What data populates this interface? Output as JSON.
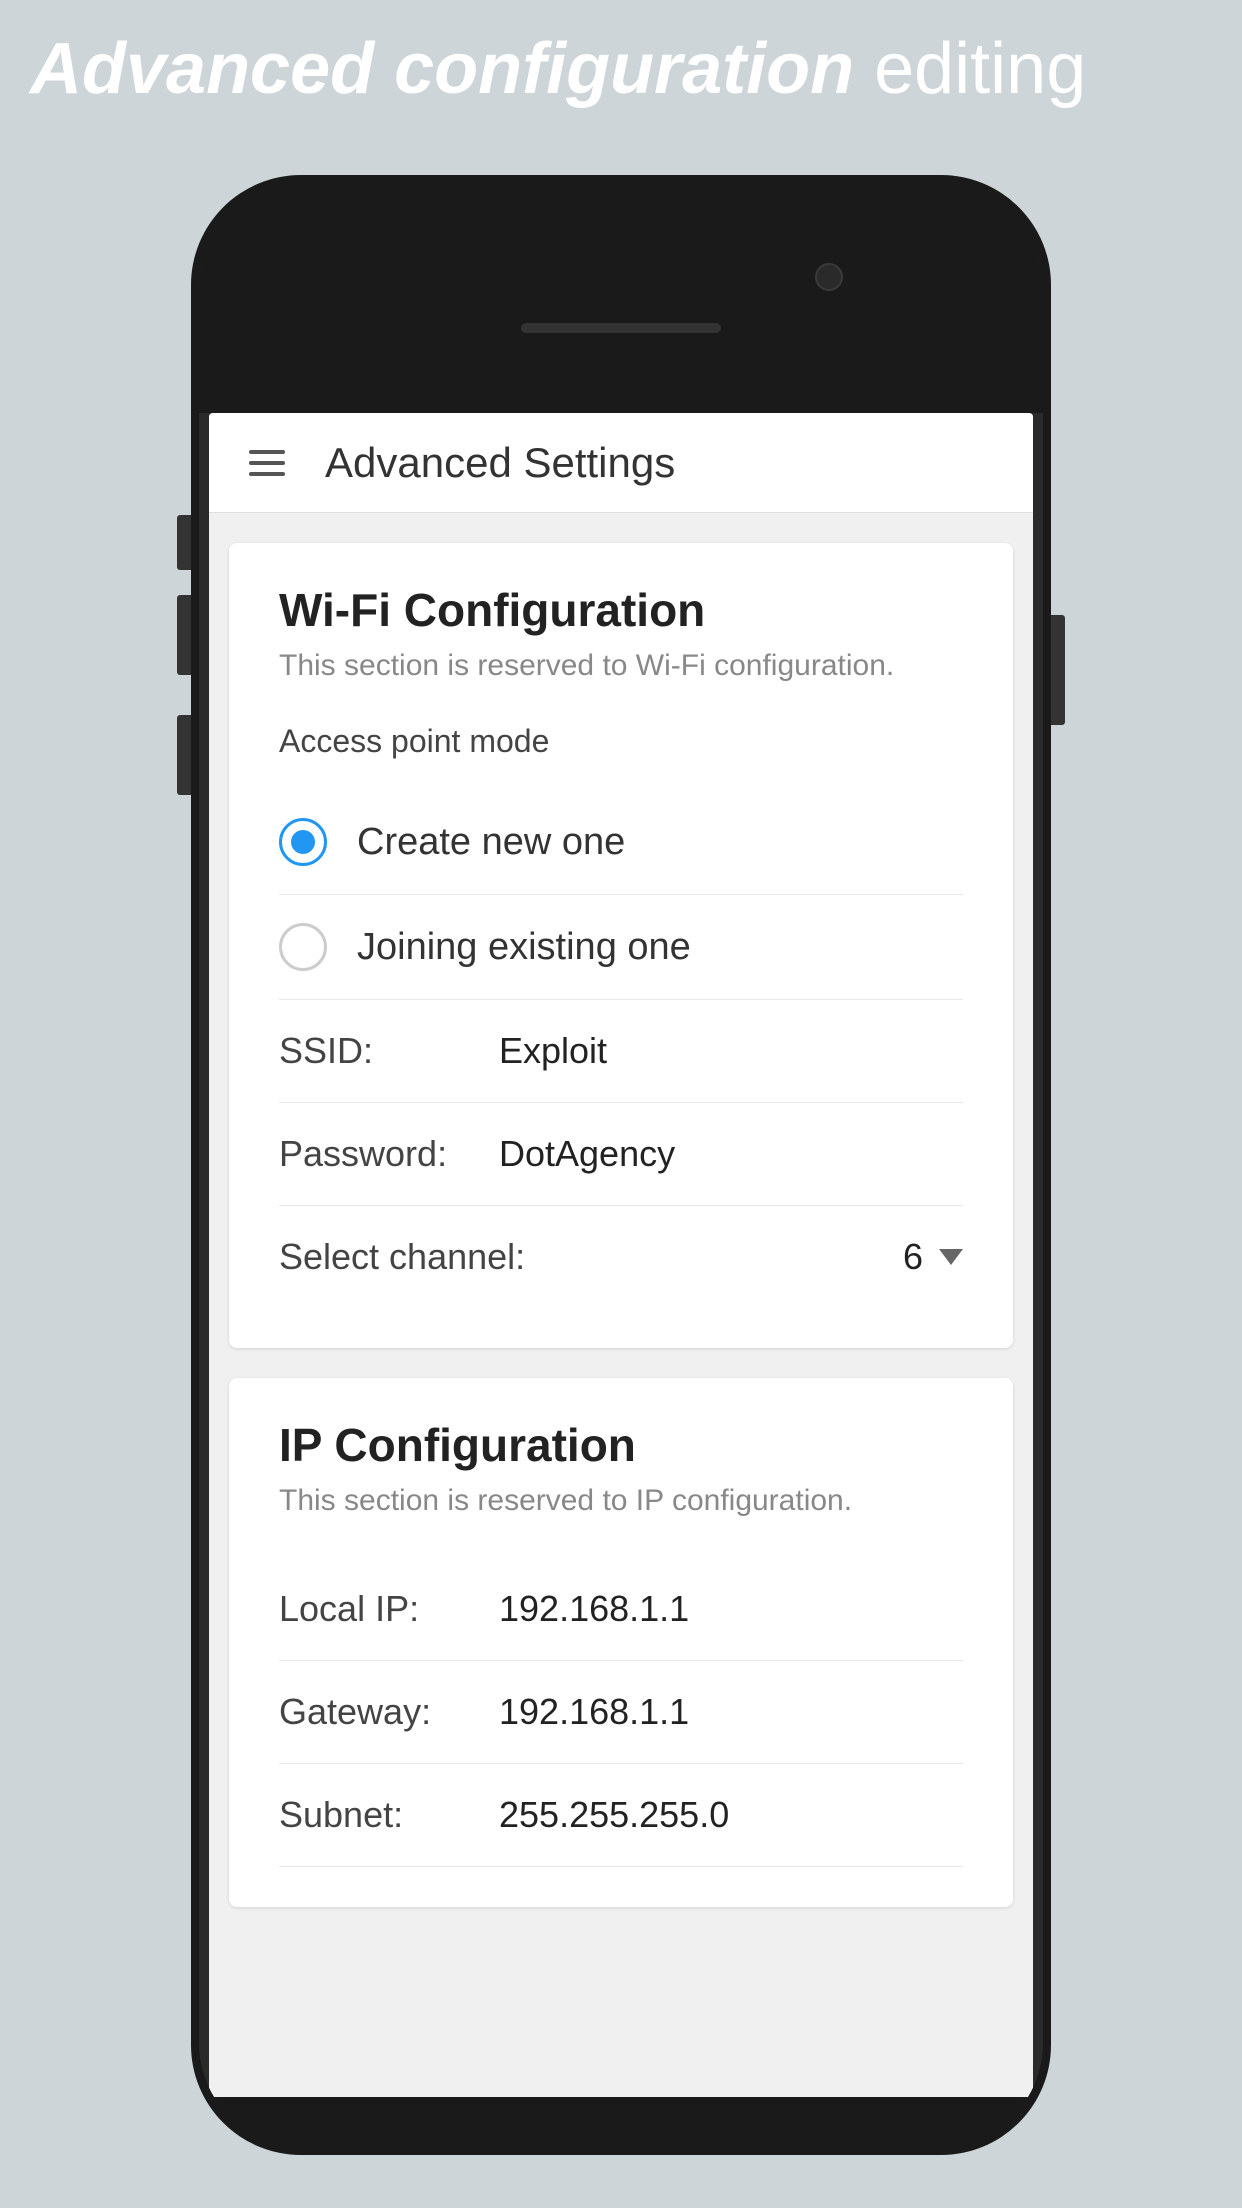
{
  "page": {
    "title_bold": "Advanced configuration",
    "title_light": " editing"
  },
  "appbar": {
    "title": "Advanced Settings"
  },
  "wifi_card": {
    "title": "Wi-Fi Configuration",
    "subtitle": "This section is reserved to Wi-Fi configuration.",
    "access_point_label": "Access point mode",
    "options": [
      {
        "id": "create",
        "label": "Create new one",
        "selected": true
      },
      {
        "id": "join",
        "label": "Joining existing one",
        "selected": false
      }
    ],
    "ssid_label": "SSID:",
    "ssid_value": "Exploit",
    "password_label": "Password:",
    "password_value": "DotAgency",
    "channel_label": "Select channel:",
    "channel_value": "6"
  },
  "ip_card": {
    "title": "IP Configuration",
    "subtitle": "This section is reserved to IP configuration.",
    "local_ip_label": "Local IP:",
    "local_ip_value": "192.168.1.1",
    "gateway_label": "Gateway:",
    "gateway_value": "192.168.1.1",
    "subnet_label": "Subnet:",
    "subnet_value": "255.255.255.0"
  },
  "icons": {
    "hamburger": "☰",
    "dropdown": "▼"
  }
}
